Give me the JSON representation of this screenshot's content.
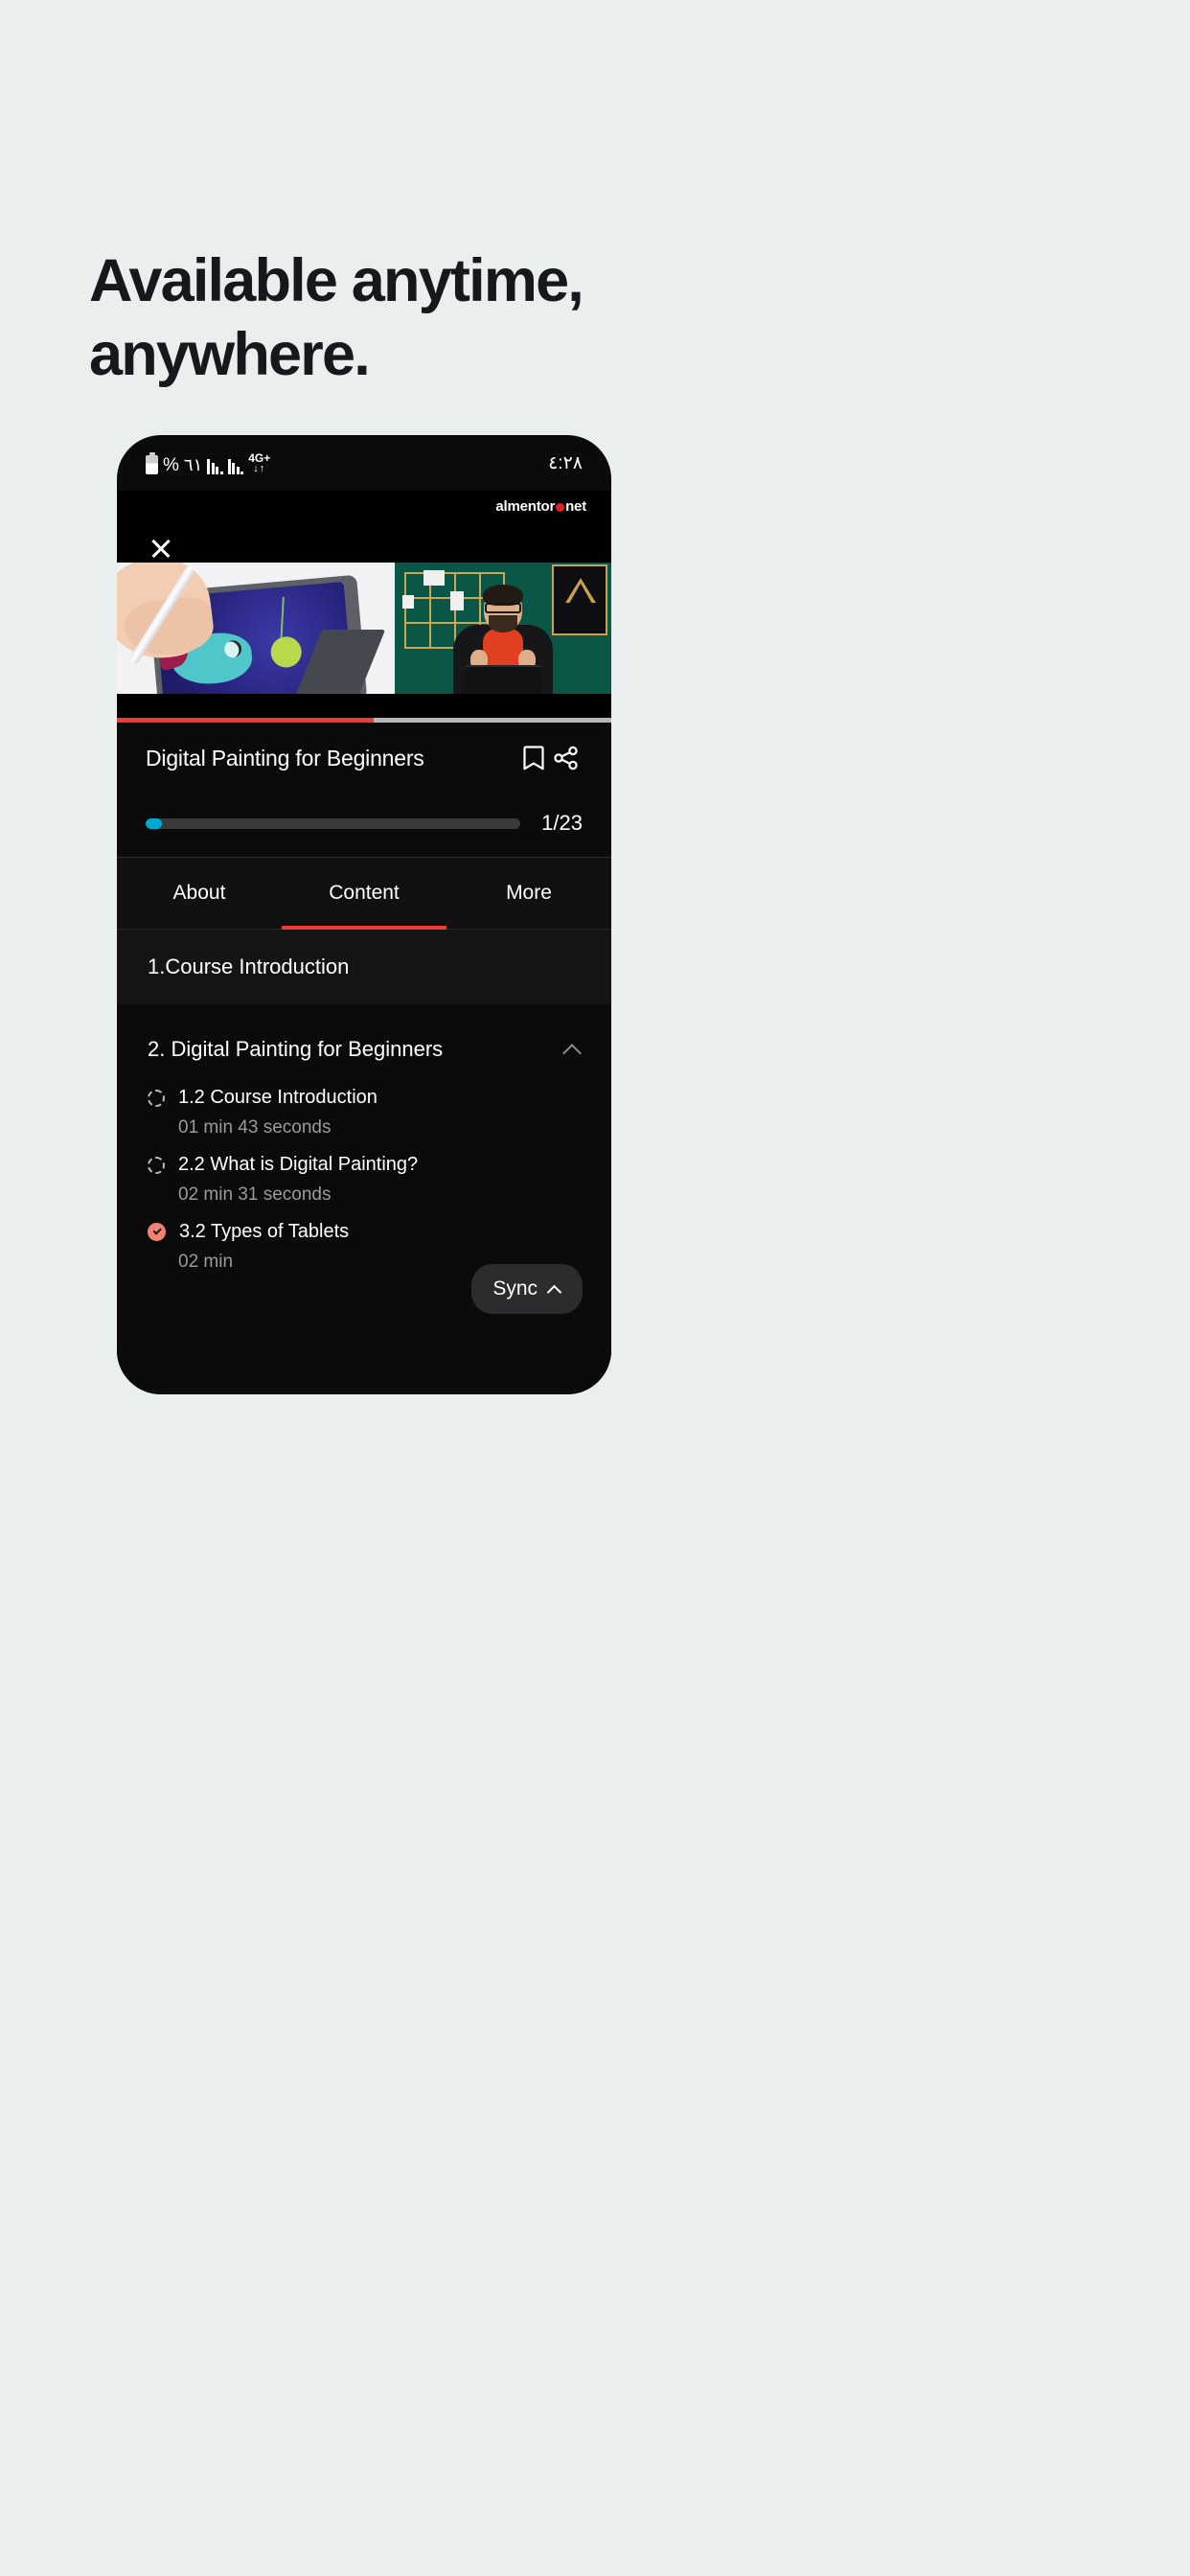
{
  "headline": {
    "line1": "Available anytime,",
    "line2": "anywhere."
  },
  "phone": {
    "status_bar": {
      "battery_percent_glyph": "%",
      "arabic_one": "٦١",
      "network_label": "4G+",
      "network_arrows": "↓↑",
      "time": "٤:٢٨"
    },
    "brand": {
      "name_left": "almentor",
      "name_right": "net",
      "dot": "•",
      "accent_color": "#e02020"
    },
    "player": {
      "close_label": "×",
      "seek_progress_percent": 52,
      "seek_played_color": "#ef3b34",
      "seek_track_color": "#b7b7b7"
    },
    "course": {
      "title": "Digital Painting for Beginners",
      "bookmark_icon": "bookmark-icon",
      "share_icon": "share-icon",
      "progress_percent": 4.3,
      "progress_color": "#00a9cf",
      "progress_count": "1/23"
    },
    "tabs": [
      {
        "label": "About",
        "active": false
      },
      {
        "label": "Content",
        "active": true
      },
      {
        "label": "More",
        "active": false
      }
    ],
    "sections": [
      {
        "title": "1.Course Introduction",
        "collapsed": true,
        "lessons": []
      },
      {
        "title": "2. Digital Painting for Beginners",
        "collapsed": false,
        "lessons": [
          {
            "name": "1.2 Course Introduction",
            "duration": "01 min 43 seconds",
            "completed": false
          },
          {
            "name": "2.2 What is Digital Painting?",
            "duration": "02 min 31 seconds",
            "completed": false
          },
          {
            "name": "3.2 Types of Tablets",
            "duration": "02 min",
            "completed": true
          }
        ]
      }
    ],
    "sync_button": {
      "label": "Sync",
      "chevron": "chevron-up-icon"
    }
  }
}
